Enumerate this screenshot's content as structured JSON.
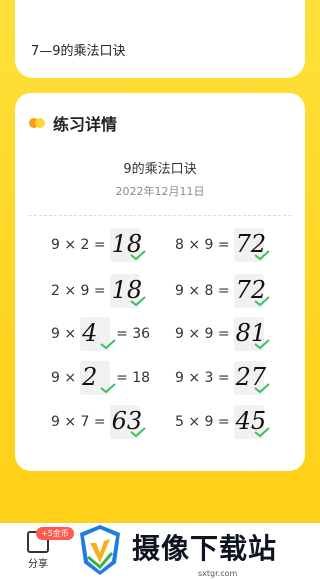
{
  "top_card": {
    "item_text": "7—9的乘法口诀"
  },
  "detail": {
    "header": "练习详情",
    "title": "9的乘法口诀",
    "date": "2022年12月11日"
  },
  "rows": [
    {
      "left": {
        "a": "9 × 2 =",
        "ans": "18",
        "b": ""
      },
      "right": {
        "a": "8 × 9 =",
        "ans": "72",
        "b": ""
      }
    },
    {
      "left": {
        "a": "2 × 9 =",
        "ans": "18",
        "b": ""
      },
      "right": {
        "a": "9 × 8 =",
        "ans": "72",
        "b": ""
      }
    },
    {
      "left": {
        "a": "9 ×",
        "ans": "4",
        "b": "= 36"
      },
      "right": {
        "a": "9 × 9 =",
        "ans": "81",
        "b": ""
      }
    },
    {
      "left": {
        "a": "9 ×",
        "ans": "2",
        "b": "= 18"
      },
      "right": {
        "a": "9 × 3 =",
        "ans": "27",
        "b": ""
      }
    },
    {
      "left": {
        "a": "9 × 7 =",
        "ans": "63",
        "b": ""
      },
      "right": {
        "a": "5 × 9 =",
        "ans": "45",
        "b": ""
      }
    }
  ],
  "bottom": {
    "share_label": "分享",
    "badge": "+5金币",
    "watermark": "摄像下载站",
    "watermark_url": "sxtgr.com"
  },
  "colors": {
    "bg": "#ffd41f",
    "accent": "#ff9c1a",
    "check": "#3fbf5f"
  }
}
